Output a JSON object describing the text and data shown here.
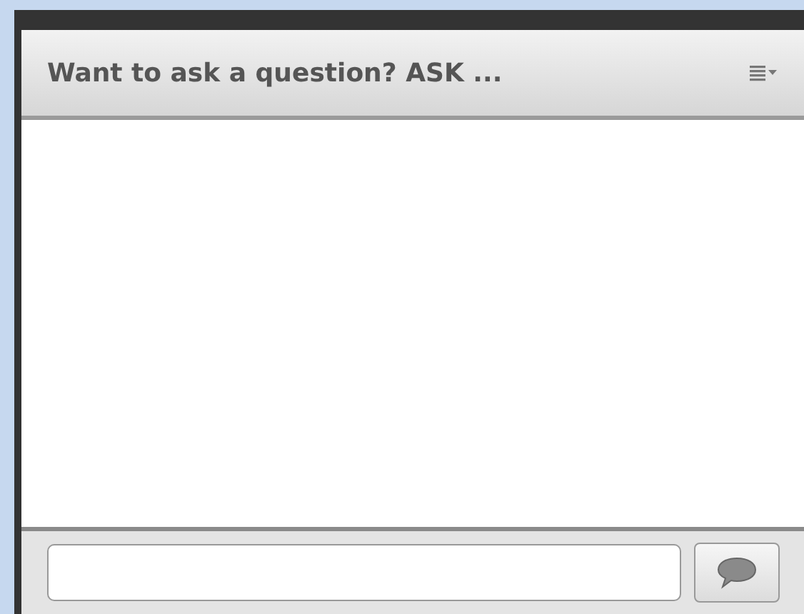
{
  "panel": {
    "title": "Want to ask a question? ASK ..."
  }
}
